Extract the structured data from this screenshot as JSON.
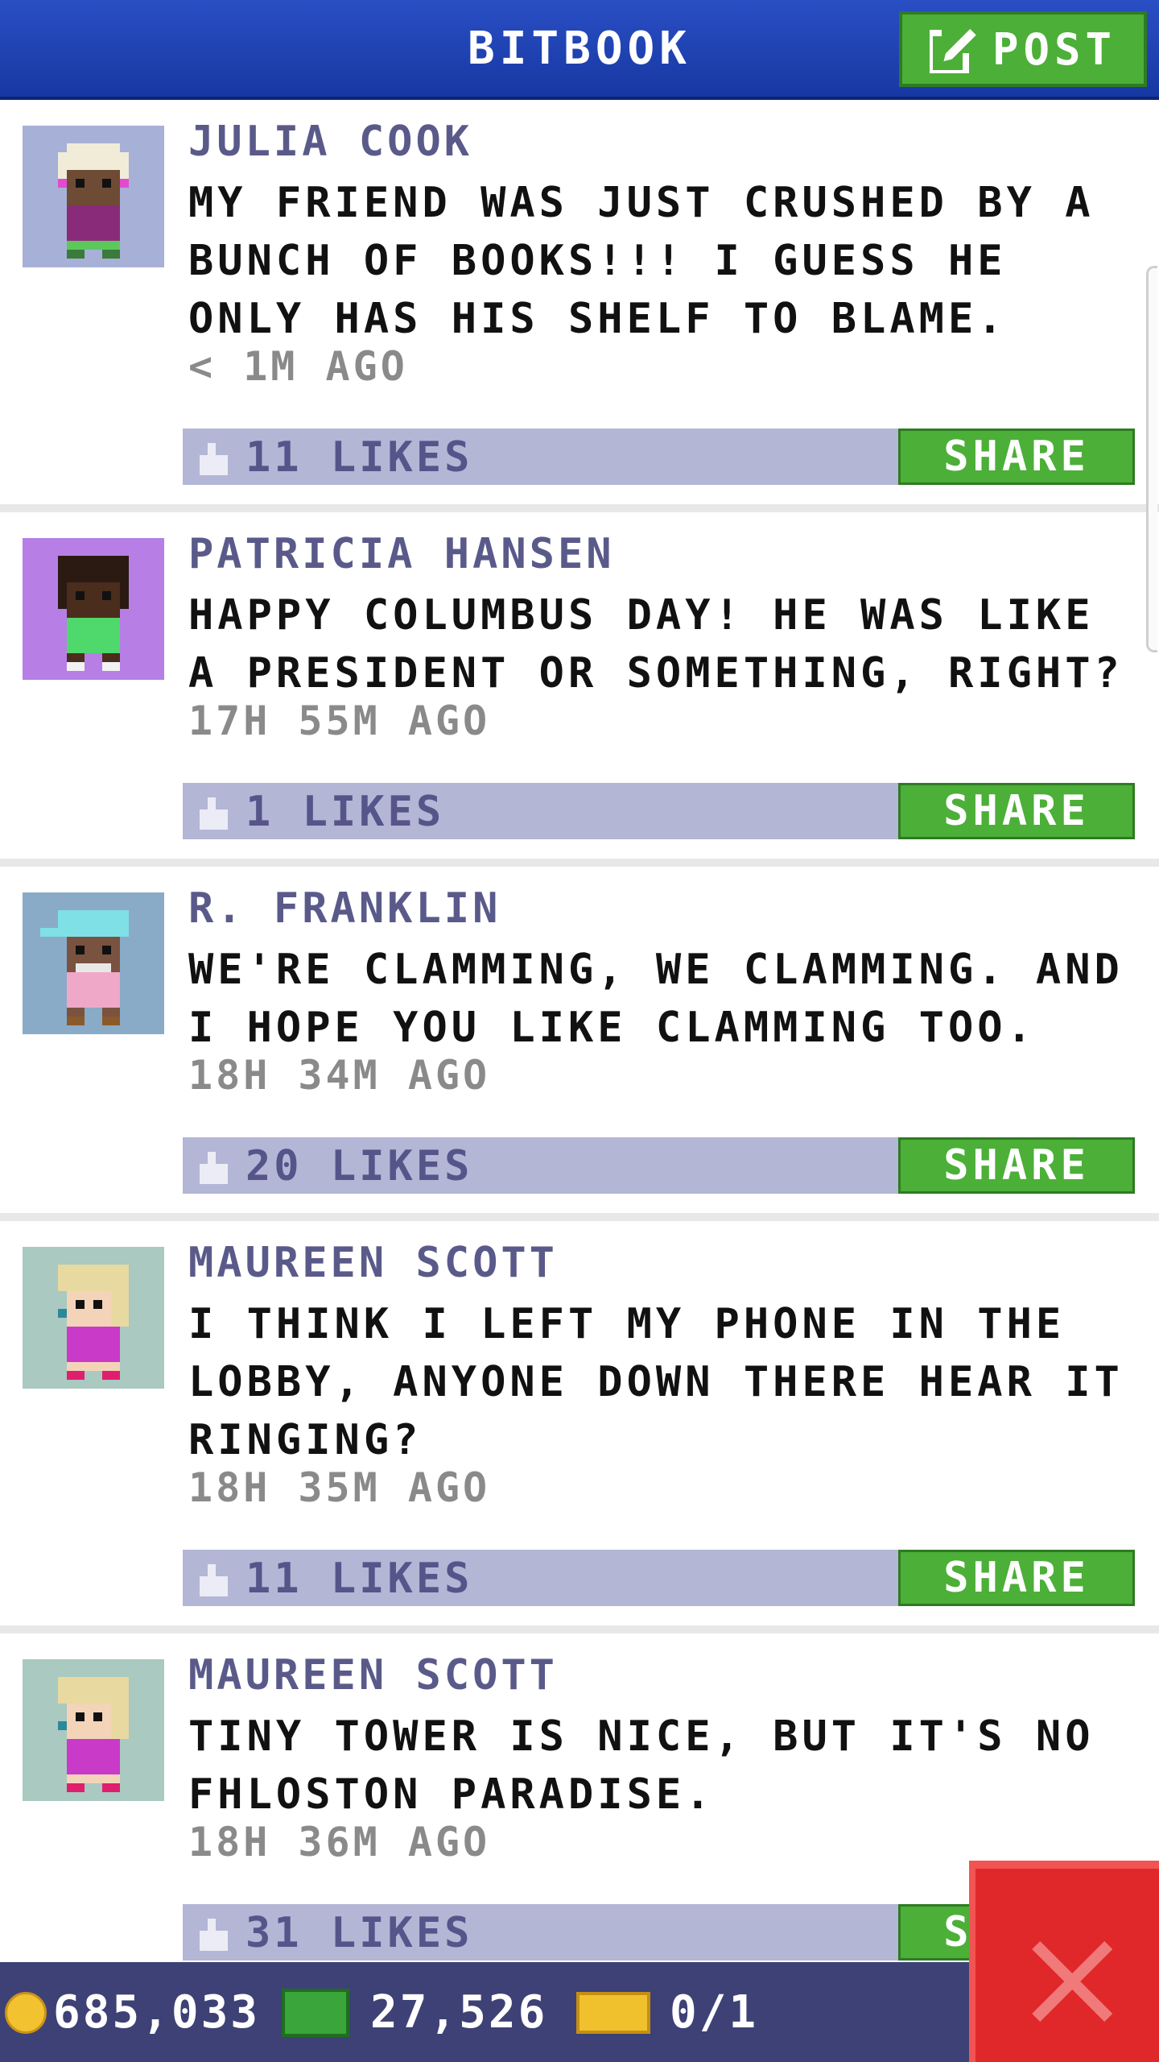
{
  "header": {
    "title": "BITBOOK",
    "post_label": "POST"
  },
  "posts": [
    {
      "name": "JULIA COOK",
      "text": "MY FRIEND WAS JUST CRUSHED BY A BUNCH OF BOOKS!!! I GUESS HE ONLY HAS HIS SHELF TO BLAME.",
      "time": "< 1M AGO",
      "likes": "11 LIKES",
      "share": "SHARE",
      "avatar_bg": "#a7b0d6"
    },
    {
      "name": "PATRICIA HANSEN",
      "text": "HAPPY COLUMBUS DAY! HE WAS LIKE A PRESIDENT OR SOMETHING, RIGHT?",
      "time": "17H 55M AGO",
      "likes": "1 LIKES",
      "share": "SHARE",
      "avatar_bg": "#b77ee6"
    },
    {
      "name": "R. FRANKLIN",
      "text": "WE'RE CLAMMING, WE CLAMMING. AND I HOPE YOU LIKE CLAMMING TOO.",
      "time": "18H 34M AGO",
      "likes": "20 LIKES",
      "share": "SHARE",
      "avatar_bg": "#89abc8"
    },
    {
      "name": "MAUREEN SCOTT",
      "text": "I THINK I LEFT MY PHONE IN THE LOBBY, ANYONE DOWN THERE HEAR IT RINGING?",
      "time": "18H 35M AGO",
      "likes": "11 LIKES",
      "share": "SHARE",
      "avatar_bg": "#a9c9c1"
    },
    {
      "name": "MAUREEN SCOTT",
      "text": "TINY TOWER IS NICE, BUT IT'S NO FHLOSTON PARADISE.",
      "time": "18H 36M AGO",
      "likes": "31 LIKES",
      "share": "SHARE",
      "avatar_bg": "#a9c9c1"
    }
  ],
  "bottom_bar": {
    "coins": "685,033",
    "bux": "27,526",
    "tickets": "0/1"
  },
  "icons": {
    "post": "edit-icon",
    "like": "thumbs-up-icon",
    "coin": "coin-icon",
    "bux": "bux-icon",
    "ticket": "ticket-icon",
    "close": "close-icon"
  },
  "colors": {
    "header_blue": "#1f42b3",
    "button_green": "#4caf38",
    "like_bar": "#b4b6d6",
    "close_red": "#e0282a",
    "bottom_bar": "#3d4175"
  }
}
